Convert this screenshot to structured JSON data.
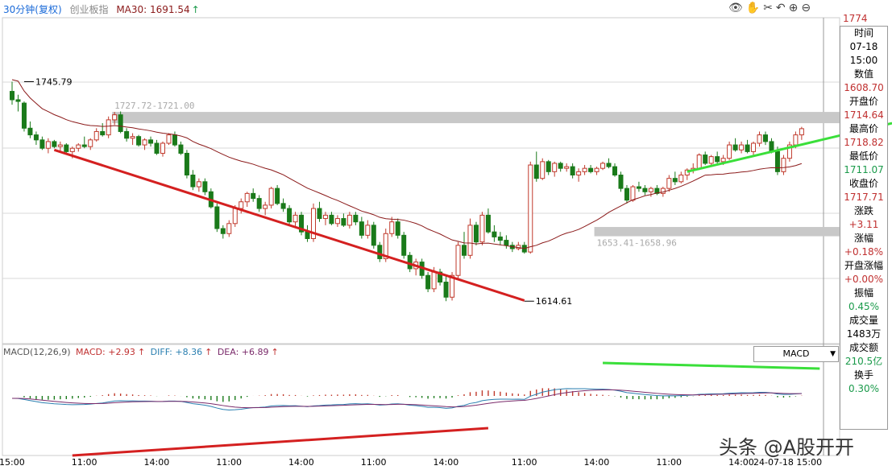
{
  "header": {
    "period": "30分钟(复权)",
    "index_name": "创业板指",
    "ma_label": "MA30: 1691.54",
    "ma_arrow": "↑"
  },
  "toolbar": {
    "icons": [
      "eye-icon",
      "hand-icon",
      "scissors-icon",
      "undo-icon",
      "zoom-in-icon",
      "zoom-out-icon"
    ],
    "glyphs": "👁✋✂↶⊕⊖"
  },
  "macd_header": {
    "name": "MACD(12,26,9)",
    "macd": "MACD: +2.93",
    "macd_arrow": "↑",
    "diff": "DIFF: +8.36",
    "diff_arrow": "↑",
    "dea": "DEA: +6.89",
    "dea_arrow": "↑"
  },
  "macd_select": {
    "value": "MACD"
  },
  "info_panel": [
    {
      "label": "时间",
      "value": "07-18"
    },
    {
      "label": "15:00",
      "value": ""
    },
    {
      "label": "数值",
      "value": "1608.70"
    },
    {
      "label": "开盘价",
      "value": "1714.64"
    },
    {
      "label": "最高价",
      "value": "1718.82"
    },
    {
      "label": "最低价",
      "value": "1711.07"
    },
    {
      "label": "收盘价",
      "value": "1717.71"
    },
    {
      "label": "涨跌",
      "value": "+3.11"
    },
    {
      "label": "涨幅",
      "value": "+0.18%"
    },
    {
      "label": "开盘涨幅",
      "value": "+0.00%"
    },
    {
      "label": "振幅",
      "value": "0.45%"
    },
    {
      "label": "成交量",
      "value": "1483万"
    },
    {
      "label": "成交额",
      "value": "210.5亿"
    },
    {
      "label": "换手",
      "value": "0.30%"
    }
  ],
  "watermark": "头条 @A股开开",
  "colors": {
    "up": "#c0392b",
    "down": "#1a7a1a",
    "ma": "#8b1a1a",
    "trend_red": "#d42020",
    "trend_green": "#3adf3a",
    "zone": "#c8c8c8",
    "diff_line": "#2a7fb0",
    "dea_line": "#7a2a6a",
    "info_green": "#1a9a4a",
    "info_red": "#c03030"
  },
  "chart_data": {
    "type": "candlestick",
    "title": "创业板指 30分钟(复权)",
    "y_axis_top_label": "1774",
    "ylim": [
      1595,
      1785
    ],
    "price_labels": [
      {
        "text": "1745.79",
        "x": 2,
        "y": 1745.79
      },
      {
        "text": "1614.61",
        "x": 85,
        "y": 1614.61
      }
    ],
    "zones": [
      {
        "text": "1727.72-1721.00",
        "x_start": 17,
        "high": 1727.72,
        "low": 1721.0
      },
      {
        "text": "1653.41-1658.96",
        "x_start": 97,
        "high": 1658.96,
        "low": 1653.41
      }
    ],
    "trendlines": [
      {
        "color": "red",
        "points": [
          [
            7,
            1705
          ],
          [
            85,
            1615
          ]
        ]
      },
      {
        "color": "green",
        "points": [
          [
            112,
            1692
          ],
          [
            146,
            1721
          ]
        ]
      }
    ],
    "x_labels": [
      {
        "i": 0,
        "text": "15:00"
      },
      {
        "i": 12,
        "text": "11:00"
      },
      {
        "i": 24,
        "text": "14:00"
      },
      {
        "i": 36,
        "text": "11:00"
      },
      {
        "i": 48,
        "text": "14:00"
      },
      {
        "i": 60,
        "text": "11:00"
      },
      {
        "i": 72,
        "text": "14:00"
      },
      {
        "i": 85,
        "text": "11:00"
      },
      {
        "i": 97,
        "text": "14:00"
      },
      {
        "i": 109,
        "text": "11:00"
      },
      {
        "i": 121,
        "text": "14:00"
      },
      {
        "i": 134,
        "text": "24-07-18 15:00"
      }
    ],
    "ohlc": [
      [
        1740,
        1745.79,
        1732,
        1735
      ],
      [
        1735,
        1738,
        1728,
        1734
      ],
      [
        1733,
        1734,
        1716,
        1718
      ],
      [
        1718,
        1722,
        1712,
        1714
      ],
      [
        1714,
        1716,
        1708,
        1711
      ],
      [
        1711,
        1713,
        1705,
        1706
      ],
      [
        1706,
        1712,
        1703,
        1710
      ],
      [
        1710,
        1711,
        1706,
        1707
      ],
      [
        1707,
        1710,
        1704,
        1708
      ],
      [
        1708,
        1709,
        1703,
        1704
      ],
      [
        1704,
        1707,
        1700,
        1706
      ],
      [
        1706,
        1709,
        1704,
        1708
      ],
      [
        1708,
        1713,
        1706,
        1707
      ],
      [
        1707,
        1712,
        1705,
        1711
      ],
      [
        1711,
        1718,
        1710,
        1716
      ],
      [
        1716,
        1721,
        1713,
        1714
      ],
      [
        1714,
        1725,
        1712,
        1723
      ],
      [
        1723,
        1727.72,
        1720,
        1726
      ],
      [
        1726,
        1728,
        1715,
        1716
      ],
      [
        1716,
        1718,
        1710,
        1712
      ],
      [
        1712,
        1715,
        1708,
        1713
      ],
      [
        1713,
        1714,
        1707,
        1708
      ],
      [
        1708,
        1712,
        1705,
        1711
      ],
      [
        1711,
        1713,
        1707,
        1709
      ],
      [
        1709,
        1711,
        1702,
        1703
      ],
      [
        1703,
        1710,
        1701,
        1709
      ],
      [
        1709,
        1715,
        1708,
        1714
      ],
      [
        1714,
        1716,
        1707,
        1708
      ],
      [
        1708,
        1710,
        1702,
        1703
      ],
      [
        1703,
        1705,
        1688,
        1690
      ],
      [
        1690,
        1693,
        1681,
        1683
      ],
      [
        1683,
        1688,
        1680,
        1686
      ],
      [
        1686,
        1688,
        1678,
        1680
      ],
      [
        1680,
        1682,
        1670,
        1671
      ],
      [
        1671,
        1673,
        1656,
        1658
      ],
      [
        1658,
        1660,
        1652,
        1655
      ],
      [
        1655,
        1663,
        1653,
        1661
      ],
      [
        1661,
        1672,
        1659,
        1670
      ],
      [
        1670,
        1676,
        1667,
        1674
      ],
      [
        1674,
        1680,
        1671,
        1679
      ],
      [
        1679,
        1682,
        1674,
        1676
      ],
      [
        1676,
        1678,
        1668,
        1670
      ],
      [
        1670,
        1674,
        1666,
        1672
      ],
      [
        1672,
        1683,
        1670,
        1682
      ],
      [
        1682,
        1684,
        1672,
        1673
      ],
      [
        1673,
        1676,
        1668,
        1670
      ],
      [
        1670,
        1672,
        1660,
        1662
      ],
      [
        1662,
        1668,
        1659,
        1666
      ],
      [
        1666,
        1668,
        1654,
        1656
      ],
      [
        1656,
        1660,
        1650,
        1652
      ],
      [
        1652,
        1673,
        1650,
        1670
      ],
      [
        1670,
        1674,
        1662,
        1664
      ],
      [
        1664,
        1668,
        1660,
        1666
      ],
      [
        1666,
        1668,
        1660,
        1661
      ],
      [
        1661,
        1666,
        1659,
        1664
      ],
      [
        1664,
        1667,
        1659,
        1660
      ],
      [
        1660,
        1668,
        1658,
        1666
      ],
      [
        1666,
        1668,
        1660,
        1662
      ],
      [
        1662,
        1665,
        1652,
        1654
      ],
      [
        1654,
        1663,
        1652,
        1660
      ],
      [
        1660,
        1662,
        1646,
        1648
      ],
      [
        1648,
        1650,
        1638,
        1640
      ],
      [
        1640,
        1658,
        1638,
        1655
      ],
      [
        1655,
        1665,
        1653,
        1662
      ],
      [
        1662,
        1664,
        1652,
        1654
      ],
      [
        1654,
        1656,
        1640,
        1642
      ],
      [
        1642,
        1644,
        1632,
        1634
      ],
      [
        1634,
        1640,
        1630,
        1638
      ],
      [
        1638,
        1640,
        1628,
        1630
      ],
      [
        1630,
        1632,
        1620,
        1622
      ],
      [
        1622,
        1635,
        1620,
        1632
      ],
      [
        1632,
        1634,
        1624,
        1626
      ],
      [
        1626,
        1630,
        1614.61,
        1617
      ],
      [
        1617,
        1632,
        1615,
        1630
      ],
      [
        1630,
        1650,
        1628,
        1648
      ],
      [
        1648,
        1656,
        1640,
        1642
      ],
      [
        1642,
        1664,
        1640,
        1660
      ],
      [
        1660,
        1662,
        1648,
        1650
      ],
      [
        1650,
        1668,
        1648,
        1666
      ],
      [
        1666,
        1670,
        1655,
        1656
      ],
      [
        1656,
        1660,
        1650,
        1653
      ],
      [
        1653,
        1656,
        1648,
        1651
      ],
      [
        1651,
        1654,
        1646,
        1648
      ],
      [
        1648,
        1650,
        1644,
        1646
      ],
      [
        1646,
        1650,
        1645,
        1648
      ],
      [
        1648,
        1650,
        1643,
        1644
      ],
      [
        1644,
        1698,
        1643,
        1696
      ],
      [
        1696,
        1704,
        1686,
        1688
      ],
      [
        1688,
        1700,
        1687,
        1698
      ],
      [
        1698,
        1699,
        1690,
        1692
      ],
      [
        1692,
        1698,
        1689,
        1697
      ],
      [
        1697,
        1698,
        1692,
        1694
      ],
      [
        1694,
        1697,
        1692,
        1695
      ],
      [
        1695,
        1697,
        1688,
        1690
      ],
      [
        1690,
        1694,
        1686,
        1692
      ],
      [
        1692,
        1696,
        1690,
        1694
      ],
      [
        1694,
        1696,
        1691,
        1692
      ],
      [
        1692,
        1695,
        1690,
        1694
      ],
      [
        1694,
        1698,
        1693,
        1697
      ],
      [
        1697,
        1700,
        1694,
        1695
      ],
      [
        1695,
        1697,
        1689,
        1690
      ],
      [
        1690,
        1692,
        1680,
        1682
      ],
      [
        1682,
        1684,
        1673,
        1675
      ],
      [
        1675,
        1684,
        1674,
        1683
      ],
      [
        1683,
        1686,
        1680,
        1682
      ],
      [
        1682,
        1684,
        1678,
        1680
      ],
      [
        1680,
        1683,
        1677,
        1682
      ],
      [
        1682,
        1684,
        1678,
        1679
      ],
      [
        1679,
        1683,
        1677,
        1682
      ],
      [
        1682,
        1690,
        1680,
        1688
      ],
      [
        1688,
        1692,
        1684,
        1686
      ],
      [
        1686,
        1692,
        1685,
        1690
      ],
      [
        1690,
        1694,
        1687,
        1693
      ],
      [
        1693,
        1697,
        1691,
        1694
      ],
      [
        1694,
        1703,
        1693,
        1702
      ],
      [
        1702,
        1704,
        1696,
        1697
      ],
      [
        1697,
        1702,
        1695,
        1701
      ],
      [
        1701,
        1704,
        1697,
        1698
      ],
      [
        1698,
        1702,
        1696,
        1700
      ],
      [
        1700,
        1710,
        1699,
        1708
      ],
      [
        1708,
        1712,
        1704,
        1705
      ],
      [
        1705,
        1710,
        1703,
        1708
      ],
      [
        1708,
        1711,
        1703,
        1704
      ],
      [
        1704,
        1710,
        1702,
        1709
      ],
      [
        1709,
        1716,
        1707,
        1714
      ],
      [
        1714,
        1716,
        1708,
        1710
      ],
      [
        1710,
        1712,
        1703,
        1704
      ],
      [
        1704,
        1707,
        1690,
        1692
      ],
      [
        1692,
        1702,
        1690,
        1700
      ],
      [
        1700,
        1710,
        1698,
        1708
      ],
      [
        1708,
        1716,
        1706,
        1714
      ],
      [
        1714,
        1718.82,
        1711,
        1717.71
      ]
    ],
    "macd": {
      "hist_range": [
        -55,
        55
      ],
      "line_range": [
        -65,
        40
      ]
    }
  }
}
